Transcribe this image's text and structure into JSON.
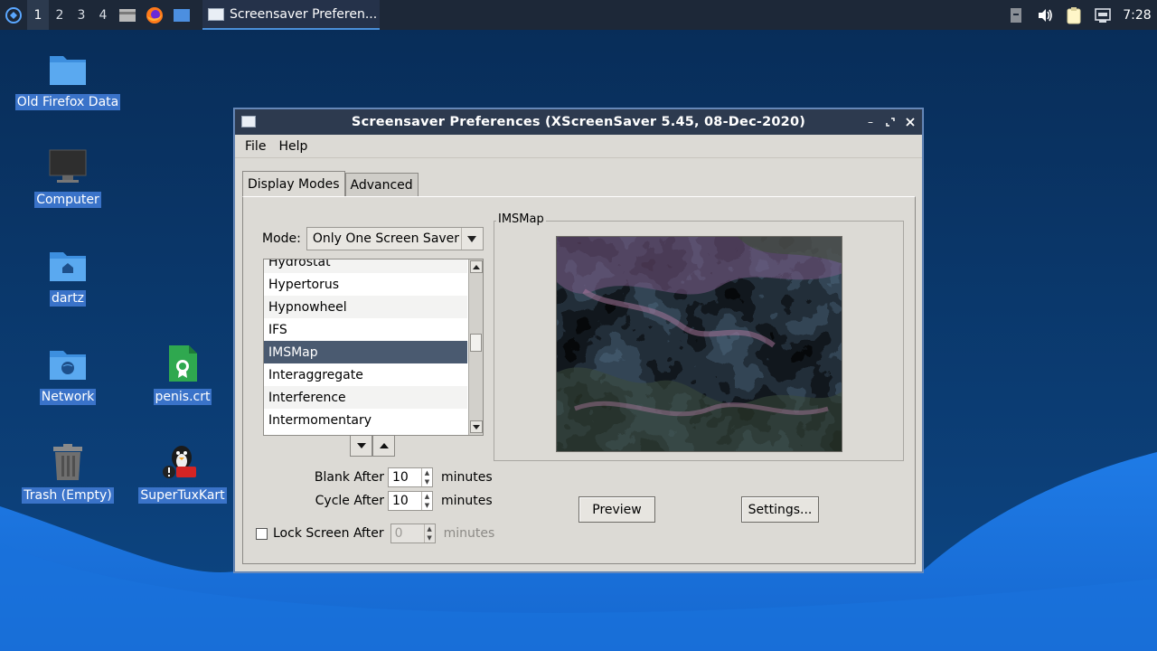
{
  "colors": {
    "desktop_top": "#0b3a6b",
    "desktop_wave": "#1a73e0",
    "titlebar": "#2d3a4f",
    "selection": "#4a5a70",
    "icon_label_bg": "#3a73c9"
  },
  "taskbar": {
    "workspaces": [
      "1",
      "2",
      "3",
      "4"
    ],
    "active_workspace": "1",
    "launchers": [
      "file-manager-icon",
      "firefox-icon",
      "desktop-icon"
    ],
    "task_title": "Screensaver Preferen...",
    "clock": "7:28",
    "tray_icons": [
      "removable-media-icon",
      "volume-icon",
      "clipboard-icon",
      "network-icon"
    ]
  },
  "desktop_icons": [
    {
      "label": "Old Firefox Data",
      "icon": "folder-icon"
    },
    {
      "label": "Computer",
      "icon": "computer-icon"
    },
    {
      "label": "dartz",
      "icon": "home-folder-icon"
    },
    {
      "label": "Network",
      "icon": "network-folder-icon"
    },
    {
      "label": "penis.crt",
      "icon": "certificate-file-icon"
    },
    {
      "label": "Trash (Empty)",
      "icon": "trash-icon"
    },
    {
      "label": "SuperTuxKart",
      "icon": "supertuxkart-icon"
    }
  ],
  "window": {
    "title": "Screensaver Preferences  (XScreenSaver 5.45, 08-Dec-2020)",
    "menu": {
      "file": "File",
      "help": "Help"
    },
    "tabs": [
      "Display Modes",
      "Advanced"
    ],
    "active_tab": "Display Modes",
    "mode_label": "Mode:",
    "mode_value": "Only One Screen Saver",
    "saver_list": [
      "Hydrostat",
      "Hypertorus",
      "Hypnowheel",
      "IFS",
      "IMSMap",
      "Interaggregate",
      "Interference",
      "Intermomentary"
    ],
    "selected_saver": "IMSMap",
    "preview_frame_label": "IMSMap",
    "blank_after": {
      "label": "Blank After",
      "value": "10",
      "unit": "minutes"
    },
    "cycle_after": {
      "label": "Cycle After",
      "value": "10",
      "unit": "minutes"
    },
    "lock_after": {
      "label": "Lock Screen After",
      "value": "0",
      "unit": "minutes",
      "checked": false,
      "enabled": false
    },
    "buttons": {
      "preview": "Preview",
      "settings": "Settings..."
    }
  }
}
